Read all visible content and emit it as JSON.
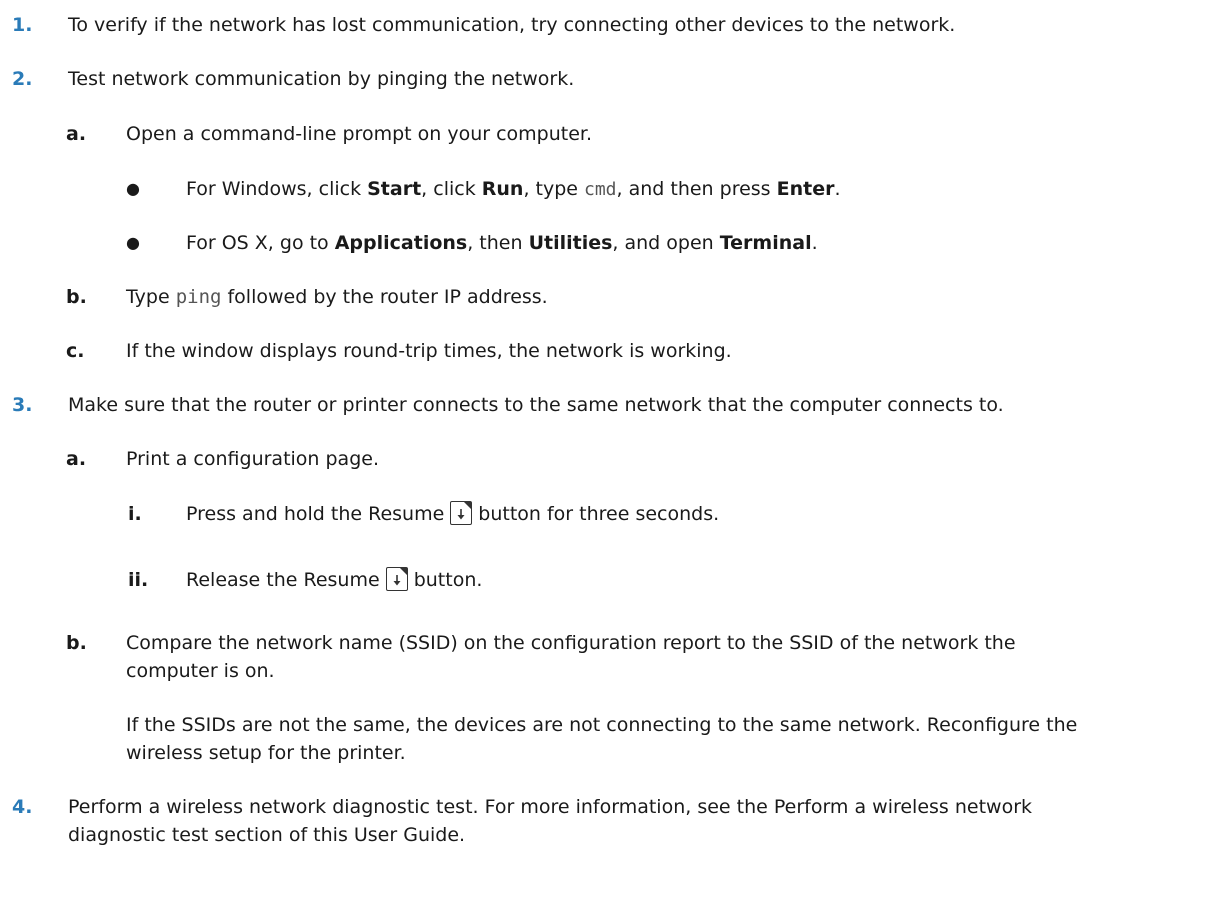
{
  "step1": {
    "num": "1.",
    "text": "To verify if the network has lost communication, try connecting other devices to the network."
  },
  "step2": {
    "num": "2.",
    "text": "Test network communication by pinging the network.",
    "a": {
      "num": "a.",
      "text": "Open a command-line prompt on your computer."
    },
    "bullet1": {
      "t1": "For Windows, click ",
      "start": "Start",
      "t2": ", click ",
      "run": "Run",
      "t3": ", type ",
      "cmd": "cmd",
      "t4": ", and then press ",
      "enter": "Enter",
      "t5": "."
    },
    "bullet2": {
      "t1": "For OS X, go to ",
      "applications": "Applications",
      "t2": ", then ",
      "utilities": "Utilities",
      "t3": ", and open ",
      "terminal": "Terminal",
      "t4": "."
    },
    "b": {
      "num": "b.",
      "t1": "Type ",
      "ping": "ping",
      "t2": " followed by the router IP address."
    },
    "c": {
      "num": "c.",
      "text": "If the window displays round-trip times, the network is working."
    }
  },
  "step3": {
    "num": "3.",
    "text": "Make sure that the router or printer connects to the same network that the computer connects to.",
    "a": {
      "num": "a.",
      "text": "Print a configuration page."
    },
    "i": {
      "num": "i.",
      "t1": "Press and hold the Resume",
      "t2": "button for three seconds."
    },
    "ii": {
      "num": "ii.",
      "t1": "Release the Resume",
      "t2": "button."
    },
    "b": {
      "num": "b.",
      "line1": "Compare the network name (SSID) on the configuration report to the SSID of the network the",
      "line2": "computer is on.",
      "para1": "If the SSIDs are not the same, the devices are not connecting to the same network. Reconfigure the",
      "para2": "wireless setup for the printer."
    }
  },
  "step4": {
    "num": "4.",
    "line1": "Perform a wireless network diagnostic test. For more information, see the Perform a wireless network",
    "line2": "diagnostic test section of this User Guide."
  },
  "colors": {
    "step_number": "#2a7bb8",
    "text": "#1a1a1a"
  }
}
